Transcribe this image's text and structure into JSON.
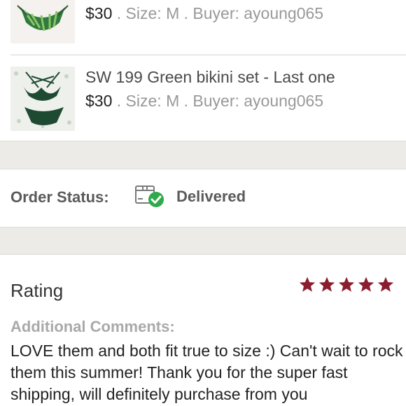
{
  "items": [
    {
      "title": "",
      "price": "$30",
      "size": "Size: M",
      "buyer": "Buyer: ayoung065",
      "thumb": "palm-print-bikini"
    },
    {
      "title": "SW 199 Green bikini set - Last one",
      "price": "$30",
      "size": "Size: M",
      "buyer": "Buyer: ayoung065",
      "thumb": "green-bikini"
    }
  ],
  "separator": " . ",
  "order_status": {
    "label": "Order Status:",
    "value": "Delivered",
    "icon": "box-check-icon",
    "check_color": "#2eaa4a"
  },
  "review": {
    "rating_label": "Rating",
    "stars": 5,
    "star_color": "#8a1e2e",
    "comments_label": "Additional Comments:",
    "comment": "LOVE them and both fit true to size :) Can't wait to rock them this summer! Thank you for the super fast shipping, will definitely purchase from you"
  }
}
